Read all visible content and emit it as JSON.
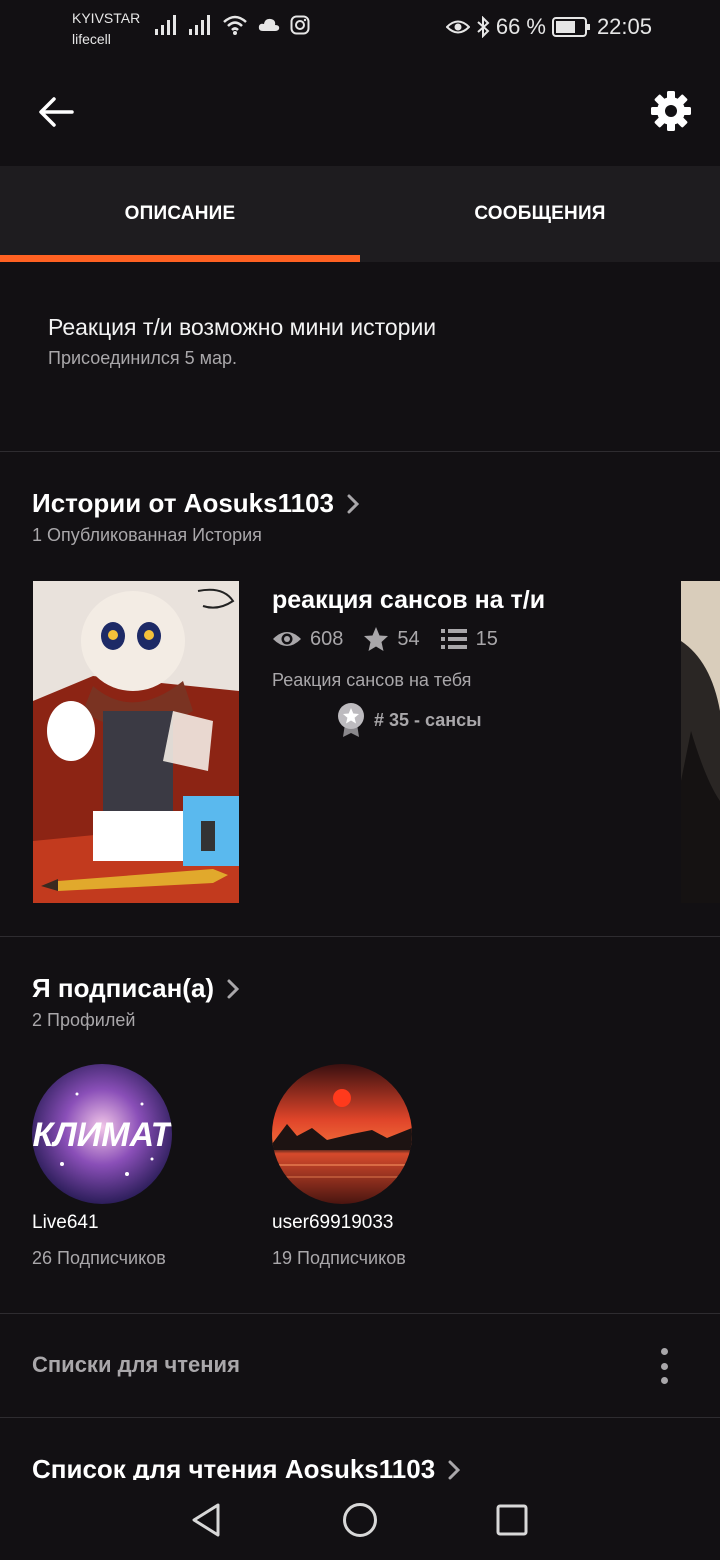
{
  "status_bar": {
    "carrier_1": "KYIVSTAR",
    "carrier_2": "lifecell",
    "battery_percent": "66 %",
    "time": "22:05"
  },
  "tabs": [
    {
      "label": "ОПИСАНИЕ",
      "active": true
    },
    {
      "label": "СООБЩЕНИЯ",
      "active": false
    }
  ],
  "about": {
    "description": "Реакция т/и возможно мини истории",
    "joined": "Присоединился 5 мар."
  },
  "stories_section": {
    "title": "Истории от Aosuks1103",
    "subtitle": "1 Опубликованная История",
    "story": {
      "title": "реакция сансов на т/и",
      "views": "608",
      "votes": "54",
      "parts": "15",
      "description": "Реакция сансов на тебя",
      "rank": "# 35 - сансы"
    }
  },
  "following_section": {
    "title": "Я подписан(а)",
    "subtitle": "2 Профилей",
    "profiles": [
      {
        "name": "Live641",
        "followers": "26 Подписчиков",
        "avatar_text": "КЛИМАТ"
      },
      {
        "name": "user69919033",
        "followers": "19 Подписчиков"
      }
    ]
  },
  "reading_lists": {
    "label": "Списки для чтения",
    "list_title": "Список для чтения Aosuks1103"
  },
  "colors": {
    "accent": "#ff6122",
    "background": "#121013",
    "tab_background": "#1e1c1f",
    "secondary_text": "#a9a7aa"
  }
}
